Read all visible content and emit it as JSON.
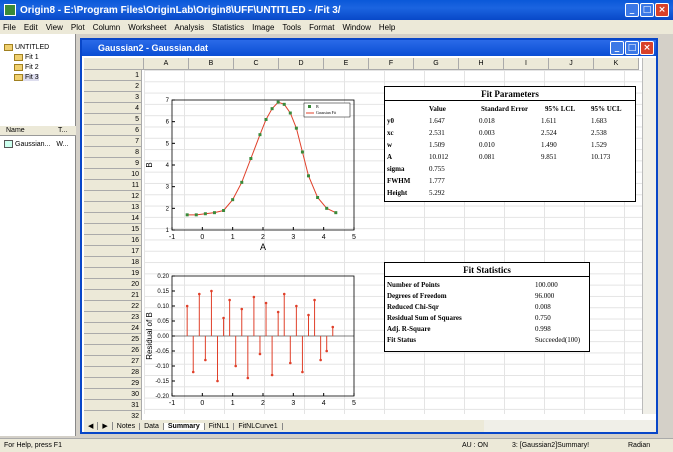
{
  "app": {
    "title": "Origin8 - E:\\Program Files\\OriginLab\\Origin8\\UFF\\UNTITLED - /Fit 3/"
  },
  "menu": [
    "File",
    "Edit",
    "View",
    "Plot",
    "Column",
    "Worksheet",
    "Analysis",
    "Statistics",
    "Image",
    "Tools",
    "Format",
    "Window",
    "Help"
  ],
  "project": {
    "root": "UNTITLED",
    "folders": [
      "Fit 1",
      "Fit 2",
      "Fit 3"
    ],
    "col_name": "Name",
    "col_type": "T...",
    "item_name": "Gaussian...",
    "item_type": "W..."
  },
  "child": {
    "title": "Gaussian2 - Gaussian.dat"
  },
  "columns": [
    "A",
    "B",
    "C",
    "D",
    "E",
    "F",
    "G",
    "H",
    "I",
    "J",
    "K"
  ],
  "rows": [
    "1",
    "2",
    "3",
    "4",
    "5",
    "6",
    "7",
    "8",
    "9",
    "10",
    "11",
    "12",
    "13",
    "14",
    "15",
    "16",
    "17",
    "18",
    "19",
    "20",
    "21",
    "22",
    "23",
    "24",
    "25",
    "26",
    "27",
    "28",
    "29",
    "30",
    "31",
    "32"
  ],
  "fit_params": {
    "title": "Fit Parameters",
    "headers": [
      "",
      "Value",
      "Standard Error",
      "95% LCL",
      "95% UCL"
    ],
    "rows": [
      [
        "y0",
        "1.647",
        "0.018",
        "1.611",
        "1.683"
      ],
      [
        "xc",
        "2.531",
        "0.003",
        "2.524",
        "2.538"
      ],
      [
        "w",
        "1.509",
        "0.010",
        "1.490",
        "1.529"
      ],
      [
        "A",
        "10.012",
        "0.081",
        "9.851",
        "10.173"
      ],
      [
        "sigma",
        "0.755",
        "",
        "",
        ""
      ],
      [
        "FWHM",
        "1.777",
        "",
        "",
        ""
      ],
      [
        "Height",
        "5.292",
        "",
        "",
        ""
      ]
    ]
  },
  "fit_stats": {
    "title": "Fit Statistics",
    "rows": [
      [
        "Number of Points",
        "100.000"
      ],
      [
        "Degrees of Freedom",
        "96.000"
      ],
      [
        "Reduced Chi-Sqr",
        "0.008"
      ],
      [
        "Residual Sum of Squares",
        "0.750"
      ],
      [
        "Adj. R-Square",
        "0.998"
      ],
      [
        "Fit Status",
        "Succeeded(100)"
      ]
    ]
  },
  "chart_data": [
    {
      "type": "scatter",
      "xlabel": "A",
      "ylabel": "B",
      "xlim": [
        -1,
        5
      ],
      "ylim": [
        1,
        7
      ],
      "xticks": [
        "-1",
        "0",
        "1",
        "2",
        "3",
        "4",
        "5"
      ],
      "yticks": [
        "1",
        "2",
        "3",
        "4",
        "5",
        "6",
        "7"
      ],
      "legend": [
        "B",
        "Gaussian Fit"
      ],
      "legend_position": "top-right",
      "series": [
        {
          "name": "B",
          "x": [
            -0.5,
            -0.2,
            0.1,
            0.4,
            0.7,
            1.0,
            1.3,
            1.6,
            1.9,
            2.1,
            2.3,
            2.5,
            2.7,
            2.9,
            3.1,
            3.3,
            3.5,
            3.8,
            4.1,
            4.4
          ],
          "y": [
            1.7,
            1.7,
            1.75,
            1.8,
            1.9,
            2.4,
            3.2,
            4.3,
            5.4,
            6.1,
            6.6,
            6.9,
            6.8,
            6.4,
            5.7,
            4.6,
            3.5,
            2.5,
            2.0,
            1.8
          ]
        }
      ]
    },
    {
      "type": "scatter",
      "xlabel": "",
      "ylabel": "Residual of B",
      "xlim": [
        -1,
        5
      ],
      "ylim": [
        -0.2,
        0.2
      ],
      "xticks": [
        "-1",
        "0",
        "1",
        "2",
        "3",
        "4",
        "5"
      ],
      "yticks": [
        "0.20",
        "0.15",
        "0.10",
        "0.05",
        "0.00",
        "-0.05",
        "-0.10",
        "-0.15",
        "-0.20"
      ],
      "series": [
        {
          "name": "Residual",
          "x": [
            -0.5,
            -0.3,
            -0.1,
            0.1,
            0.3,
            0.5,
            0.7,
            0.9,
            1.1,
            1.3,
            1.5,
            1.7,
            1.9,
            2.1,
            2.3,
            2.5,
            2.7,
            2.9,
            3.1,
            3.3,
            3.5,
            3.7,
            3.9,
            4.1,
            4.3
          ],
          "y": [
            0.1,
            -0.12,
            0.14,
            -0.08,
            0.15,
            -0.15,
            0.06,
            0.12,
            -0.1,
            0.09,
            -0.14,
            0.13,
            -0.06,
            0.11,
            -0.13,
            0.08,
            0.14,
            -0.09,
            0.1,
            -0.12,
            0.07,
            0.12,
            -0.08,
            -0.05,
            0.03
          ]
        }
      ]
    }
  ],
  "tabs": [
    "Notes",
    "Data",
    "Summary",
    "FitNL1",
    "FitNLCurve1"
  ],
  "active_tab": "Summary",
  "status": {
    "left": "For Help, press F1",
    "au": "AU : ON",
    "sheet": "3: [Gaussian2]Summary!",
    "unit": "Radian"
  }
}
